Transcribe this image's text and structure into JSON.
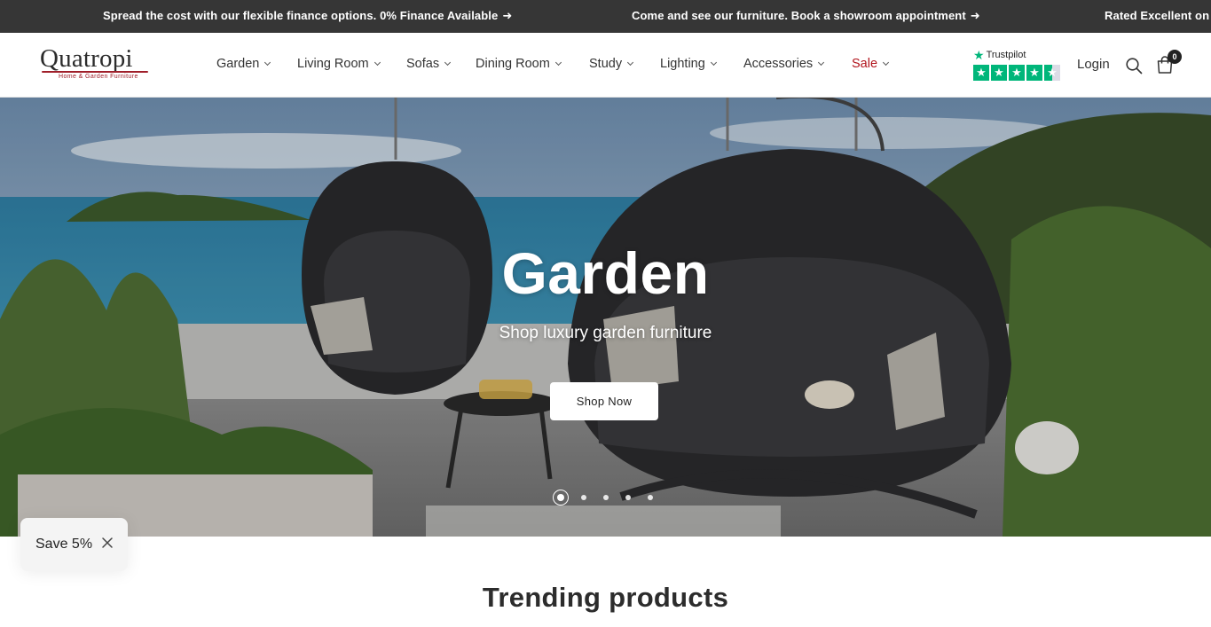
{
  "announcement": {
    "messages": [
      "Spread the cost with our flexible finance options. 0% Finance Available",
      "Come and see our furniture. Book a showroom appointment",
      "Rated Excellent on T"
    ],
    "arrow": "➜"
  },
  "brand": {
    "name": "Quatropi",
    "tagline": "Home & Garden Furniture",
    "accent_color": "#a01f2a"
  },
  "nav": {
    "items": [
      {
        "label": "Garden"
      },
      {
        "label": "Living Room"
      },
      {
        "label": "Sofas"
      },
      {
        "label": "Dining Room"
      },
      {
        "label": "Study"
      },
      {
        "label": "Lighting"
      },
      {
        "label": "Accessories"
      },
      {
        "label": "Sale",
        "color": "#b1141c"
      }
    ]
  },
  "trustpilot": {
    "label": "Trustpilot",
    "star_color": "#00b67a"
  },
  "header_actions": {
    "login": "Login",
    "search_icon": "search-icon",
    "cart_icon": "bag-icon",
    "cart_count": "0"
  },
  "hero": {
    "title": "Garden",
    "subtitle": "Shop luxury garden furniture",
    "button": "Shop Now",
    "slide_count": 5,
    "active_slide": 1
  },
  "trending": {
    "title": "Trending products"
  },
  "save_popup": {
    "label": "Save 5%",
    "close_icon": "close-icon"
  }
}
